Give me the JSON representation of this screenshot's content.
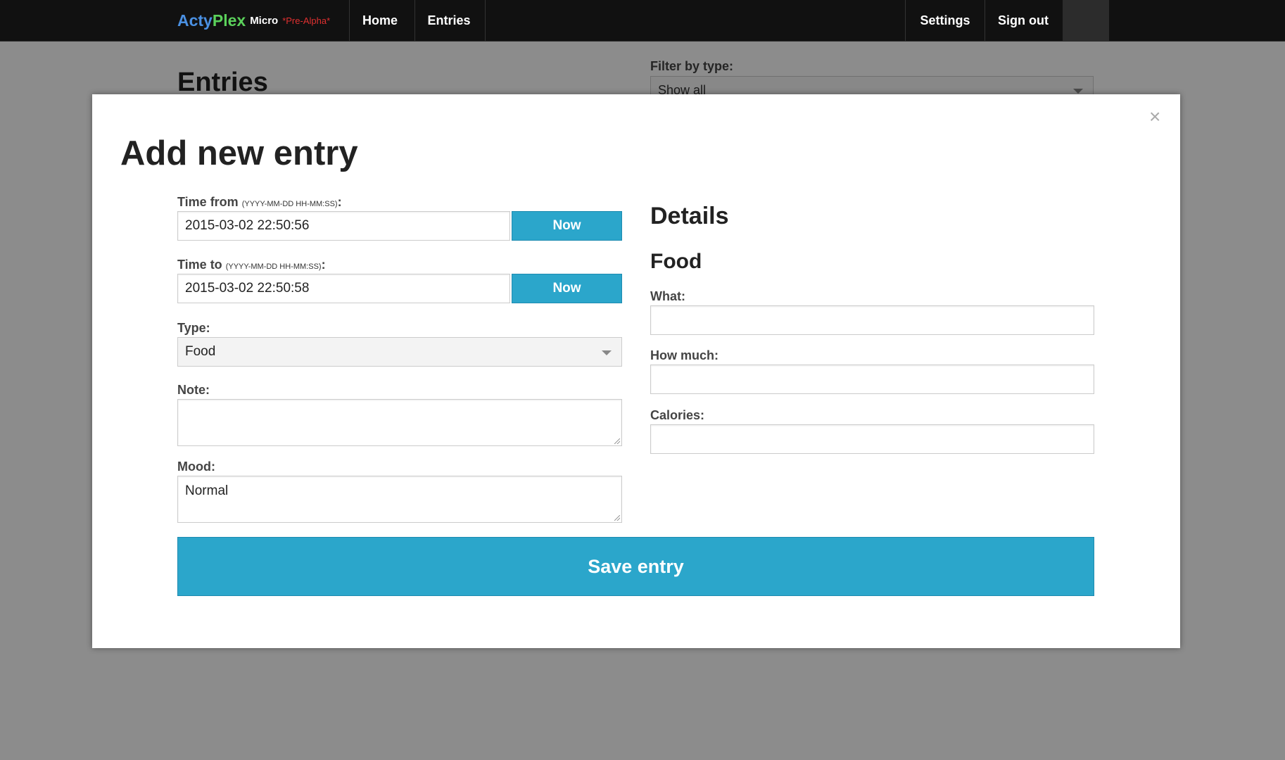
{
  "navbar": {
    "brand": {
      "part1": "Acty",
      "part2": "Plex",
      "micro": "Micro",
      "stage": "*Pre-Alpha*"
    },
    "items": [
      {
        "label": "Home"
      },
      {
        "label": "Entries"
      }
    ],
    "right_items": [
      {
        "label": "Settings"
      },
      {
        "label": "Sign out"
      }
    ]
  },
  "page": {
    "title": "Entries",
    "filter_label": "Filter by type:",
    "filter_value": "Show all"
  },
  "modal": {
    "title": "Add new entry",
    "close_symbol": "×",
    "time_from": {
      "label": "Time from",
      "hint": "(YYYY-MM-DD HH-MM:SS)",
      "suffix": ":",
      "value": "2015-03-02 22:50:56",
      "button": "Now"
    },
    "time_to": {
      "label": "Time to",
      "hint": "(YYYY-MM-DD HH-MM:SS)",
      "suffix": ":",
      "value": "2015-03-02 22:50:58",
      "button": "Now"
    },
    "type": {
      "label": "Type:",
      "value": "Food"
    },
    "note": {
      "label": "Note:",
      "value": ""
    },
    "mood": {
      "label": "Mood:",
      "value": "Normal"
    },
    "details": {
      "heading": "Details",
      "subheading": "Food",
      "what_label": "What:",
      "what_value": "",
      "how_much_label": "How much:",
      "how_much_value": "",
      "calories_label": "Calories:",
      "calories_value": ""
    },
    "save_button": "Save entry"
  },
  "colors": {
    "accent": "#2ba6cb",
    "navbar_bg": "#111111",
    "brand_acty": "#4a90e2",
    "brand_plex": "#5bd15b",
    "brand_stage": "#e03030"
  }
}
